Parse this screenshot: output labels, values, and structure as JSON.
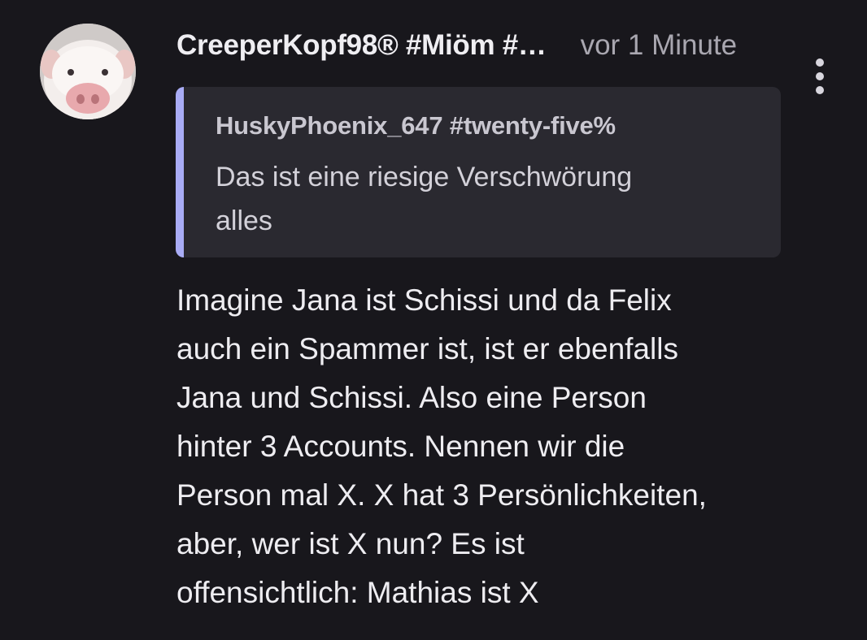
{
  "comment": {
    "author": "CreeperKopf98® #Miöm #…",
    "timestamp": "vor 1 Minute",
    "avatar_icon": "pig-avatar",
    "more_icon": "more-vert-icon",
    "quote": {
      "author": "HuskyPhoenix_647 #twenty-five%",
      "lines": [
        "Das ist eine riesige Verschwörung",
        "alles"
      ],
      "accent_color": "#a9acf5"
    },
    "body_lines": [
      "Imagine Jana ist Schissi und da Felix",
      "auch ein Spammer ist, ist er ebenfalls",
      "Jana und Schissi. Also eine Person",
      "hinter 3 Accounts. Nennen wir die",
      "Person mal X. X hat 3 Persönlichkeiten,",
      "aber, wer ist X nun? Es ist",
      "offensichtlich: Mathias ist X"
    ]
  },
  "colors": {
    "background": "#18171c",
    "quote_background": "#2a2930",
    "text_primary": "#eeedf1",
    "text_secondary": "#a9a7b0"
  }
}
